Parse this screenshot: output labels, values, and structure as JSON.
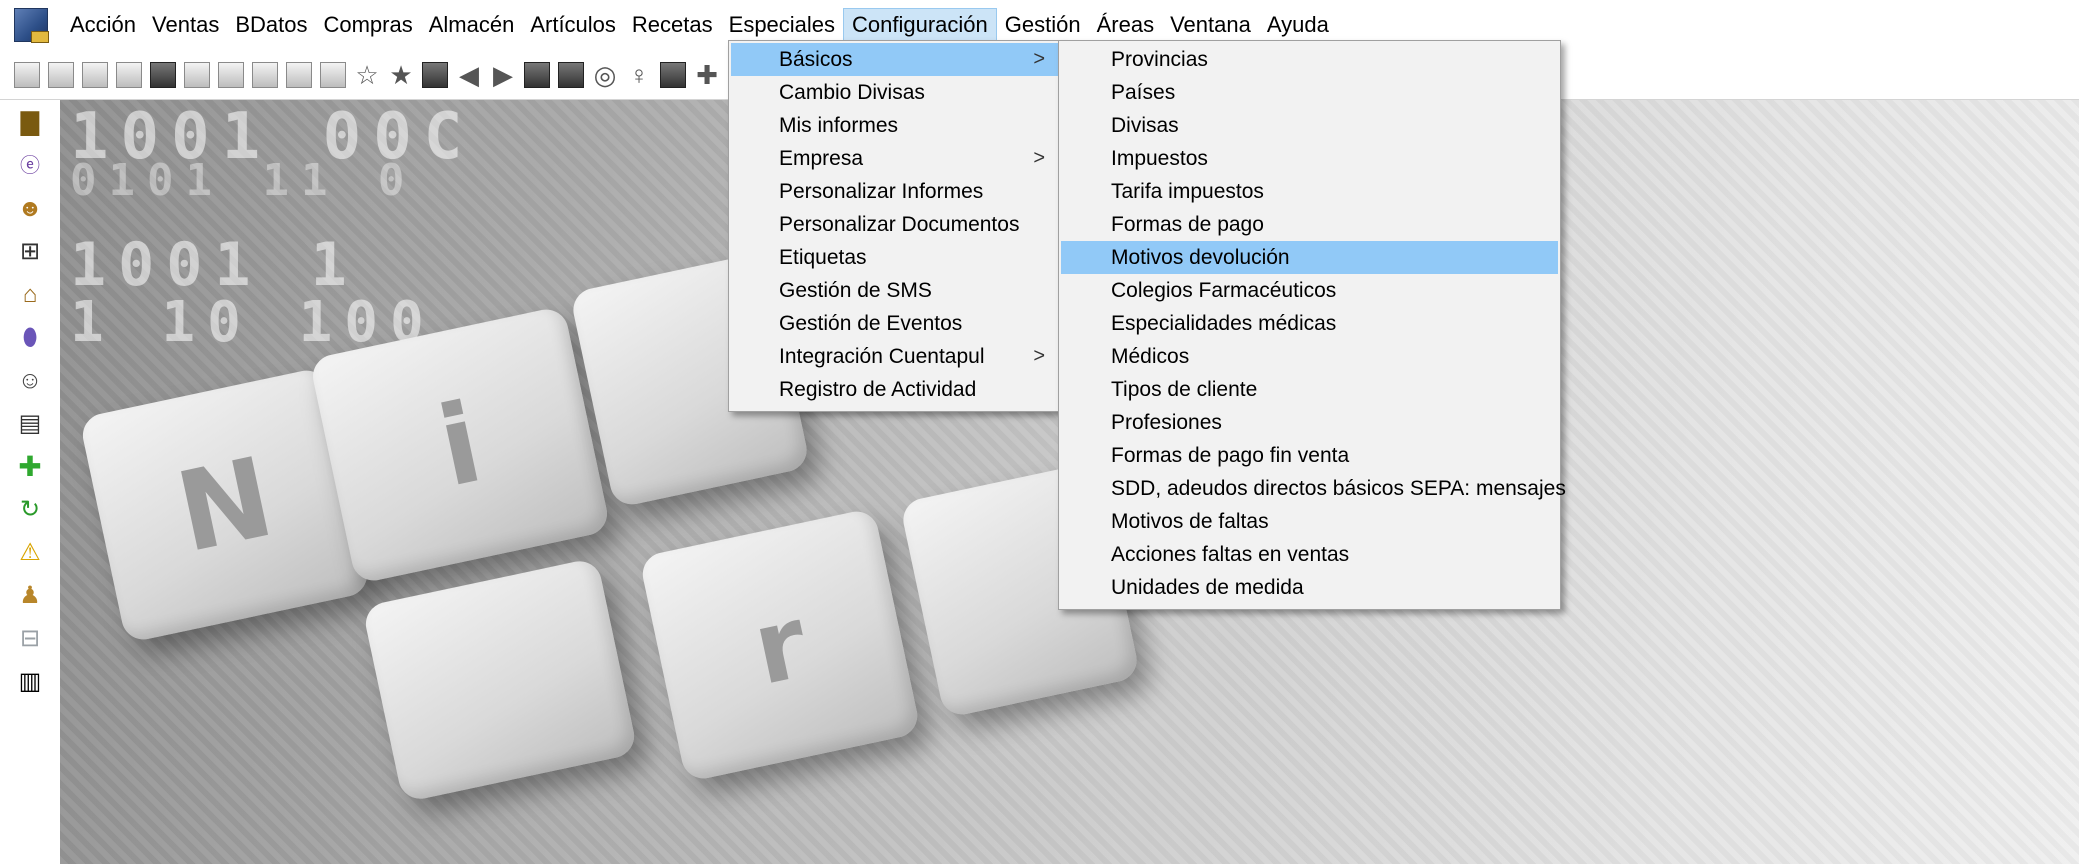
{
  "menubar": {
    "items": [
      {
        "label": "Acción"
      },
      {
        "label": "Ventas"
      },
      {
        "label": "BDatos"
      },
      {
        "label": "Compras"
      },
      {
        "label": "Almacén"
      },
      {
        "label": "Artículos"
      },
      {
        "label": "Recetas"
      },
      {
        "label": "Especiales"
      },
      {
        "label": "Configuración",
        "active": true
      },
      {
        "label": "Gestión"
      },
      {
        "label": "Áreas"
      },
      {
        "label": "Ventana"
      },
      {
        "label": "Ayuda"
      }
    ]
  },
  "config_menu": {
    "items": [
      {
        "label": "Básicos",
        "submenu": true,
        "highlighted": true
      },
      {
        "label": "Cambio Divisas"
      },
      {
        "label": "Mis informes"
      },
      {
        "label": "Empresa",
        "submenu": true
      },
      {
        "label": "Personalizar Informes"
      },
      {
        "label": "Personalizar Documentos"
      },
      {
        "label": "Etiquetas"
      },
      {
        "label": "Gestión de SMS"
      },
      {
        "label": "Gestión de Eventos"
      },
      {
        "label": "Integración Cuentapul",
        "submenu": true
      },
      {
        "label": "Registro de Actividad"
      }
    ],
    "arrow_glyph": ">"
  },
  "basicos_submenu": {
    "items": [
      {
        "label": "Provincias"
      },
      {
        "label": "Países"
      },
      {
        "label": "Divisas"
      },
      {
        "label": "Impuestos"
      },
      {
        "label": "Tarifa impuestos"
      },
      {
        "label": "Formas de pago"
      },
      {
        "label": "Motivos devolución",
        "highlighted": true
      },
      {
        "label": "Colegios Farmacéuticos"
      },
      {
        "label": "Especialidades médicas"
      },
      {
        "label": "Médicos"
      },
      {
        "label": "Tipos de cliente"
      },
      {
        "label": "Profesiones"
      },
      {
        "label": "Formas de pago fin venta"
      },
      {
        "label": "SDD, adeudos directos básicos SEPA: mensajes"
      },
      {
        "label": "Motivos de faltas"
      },
      {
        "label": "Acciones faltas en ventas"
      },
      {
        "label": "Unidades de medida"
      }
    ]
  },
  "desktop": {
    "binary_lines": [
      "1001 00C",
      "0101 11 0",
      "1001 1",
      "1 10 100"
    ],
    "keys": [
      "N",
      "i",
      "r"
    ]
  },
  "colors": {
    "menu_highlight": "#91c9f7",
    "menubar_active": "#cce4f7",
    "menu_bg": "#f2f2f2"
  }
}
